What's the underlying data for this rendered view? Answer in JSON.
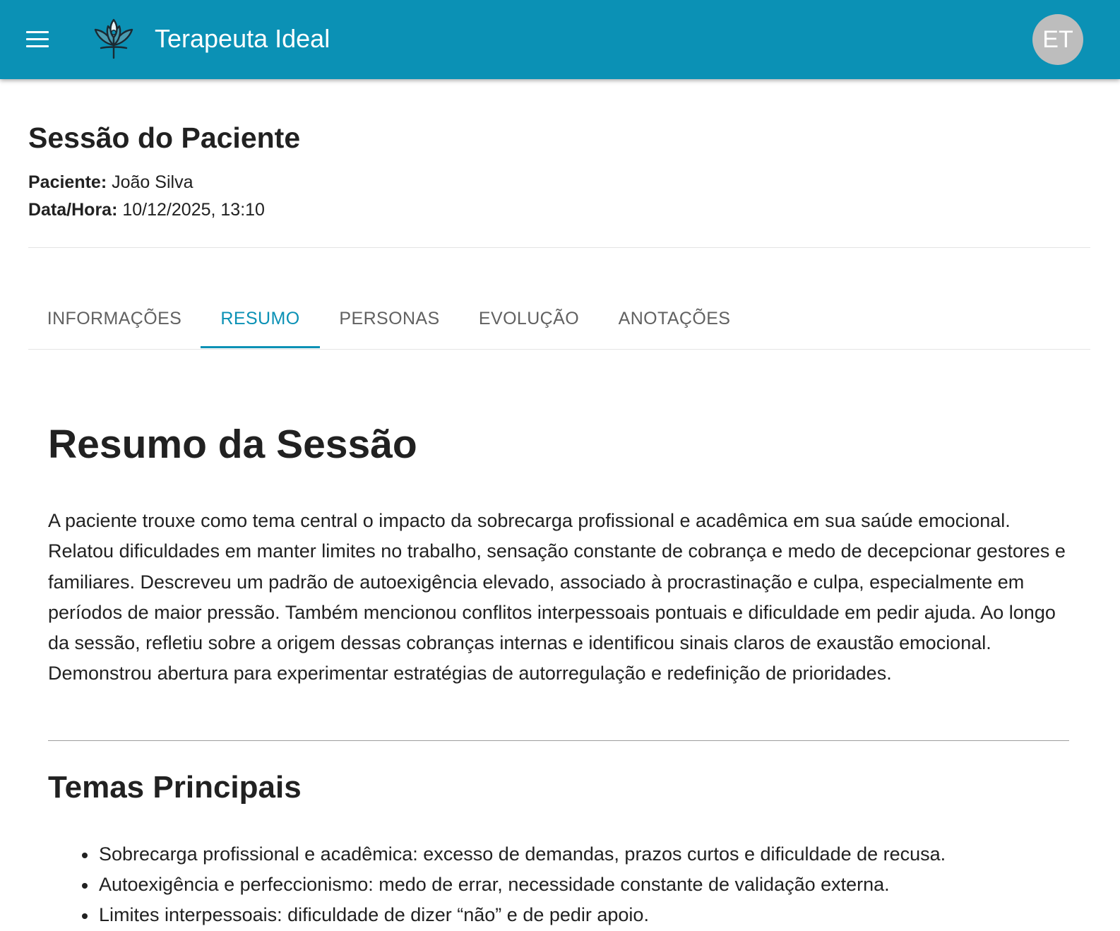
{
  "appbar": {
    "title": "Terapeuta Ideal",
    "menu_icon": "hamburger-menu-icon",
    "logo_icon": "lotus-logo-icon",
    "avatar_initials": "ET",
    "background_color": "#0b91b5"
  },
  "session": {
    "title": "Sessão do Paciente",
    "patient_label": "Paciente:",
    "patient_value": "João Silva",
    "datetime_label": "Data/Hora:",
    "datetime_value": "10/12/2025, 13:10"
  },
  "tabs": [
    {
      "label": "INFORMAÇÕES",
      "active": false
    },
    {
      "label": "RESUMO",
      "active": true
    },
    {
      "label": "PERSONAS",
      "active": false
    },
    {
      "label": "EVOLUÇÃO",
      "active": false
    },
    {
      "label": "ANOTAÇÕES",
      "active": false
    }
  ],
  "summary": {
    "title": "Resumo da Sessão",
    "text": "A paciente trouxe como tema central o impacto da sobrecarga profissional e acadêmica em sua saúde emocional. Relatou dificuldades em manter limites no trabalho, sensação constante de cobrança e medo de decepcionar gestores e familiares. Descreveu um padrão de autoexigência elevado, associado à procrastinação e culpa, especialmente em períodos de maior pressão. Também mencionou conflitos interpessoais pontuais e dificuldade em pedir ajuda. Ao longo da sessão, refletiu sobre a origem dessas cobranças internas e identificou sinais claros de exaustão emocional. Demonstrou abertura para experimentar estratégias de autorregulação e redefinição de prioridades."
  },
  "themes": {
    "title": "Temas Principais",
    "items": [
      "Sobrecarga profissional e acadêmica: excesso de demandas, prazos curtos e dificuldade de recusa.",
      "Autoexigência e perfeccionismo: medo de errar, necessidade constante de validação externa.",
      "Limites interpessoais: dificuldade de dizer “não” e de pedir apoio."
    ]
  }
}
